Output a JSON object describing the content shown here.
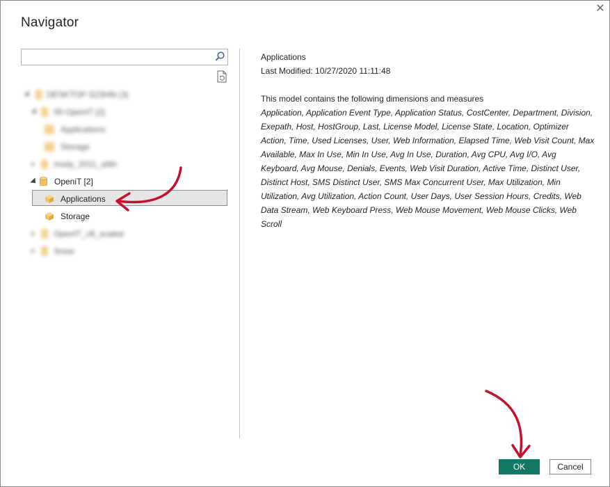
{
  "window": {
    "title": "Navigator",
    "close_glyph": "✕"
  },
  "search": {
    "placeholder": "",
    "value": ""
  },
  "tree": {
    "items": [
      {
        "label": "DESKTOP-S23HN (3)",
        "blurred": true
      },
      {
        "label": "00-OpenIT [2]",
        "blurred": true
      },
      {
        "label": "Applications",
        "blurred": true
      },
      {
        "label": "Storage",
        "blurred": true
      },
      {
        "label": "mody_2011_a9ih",
        "blurred": true
      },
      {
        "label": "OpeniT [2]",
        "blurred": false
      },
      {
        "label": "Applications",
        "blurred": false,
        "selected": true
      },
      {
        "label": "Storage",
        "blurred": false
      },
      {
        "label": "OpenIT_v8_scaled",
        "blurred": true
      },
      {
        "label": "Snow",
        "blurred": true
      }
    ]
  },
  "detail": {
    "name": "Applications",
    "last_modified": "Last Modified: 10/27/2020 11:11:48",
    "intro": "This model contains the following dimensions and measures",
    "dimensions": "Application, Application Event Type, Application Status, CostCenter, Department, Division, Exepath, Host, HostGroup, Last, License Model, License State, Location, Optimizer Action, Time, Used Licenses, User, Web Information, Elapsed Time, Web Visit Count, Max Available, Max In Use, Min In Use, Avg In Use, Duration, Avg CPU, Avg I/O, Avg Keyboard, Avg Mouse, Denials, Events, Web Visit Duration, Active Time, Distinct User, Distinct Host, SMS Distinct User, SMS Max Concurrent User, Max Utilization, Min Utilization, Avg Utilization, Action Count, User Days, User Session Hours, Credits, Web Data Stream, Web Keyboard Press, Web Mouse Movement, Web Mouse Clicks, Web Scroll"
  },
  "buttons": {
    "ok": "OK",
    "cancel": "Cancel"
  },
  "colors": {
    "accent": "#117865",
    "annotation_arrow": "#c8102e",
    "cube": "#f2c069",
    "database": "#f2c069"
  }
}
